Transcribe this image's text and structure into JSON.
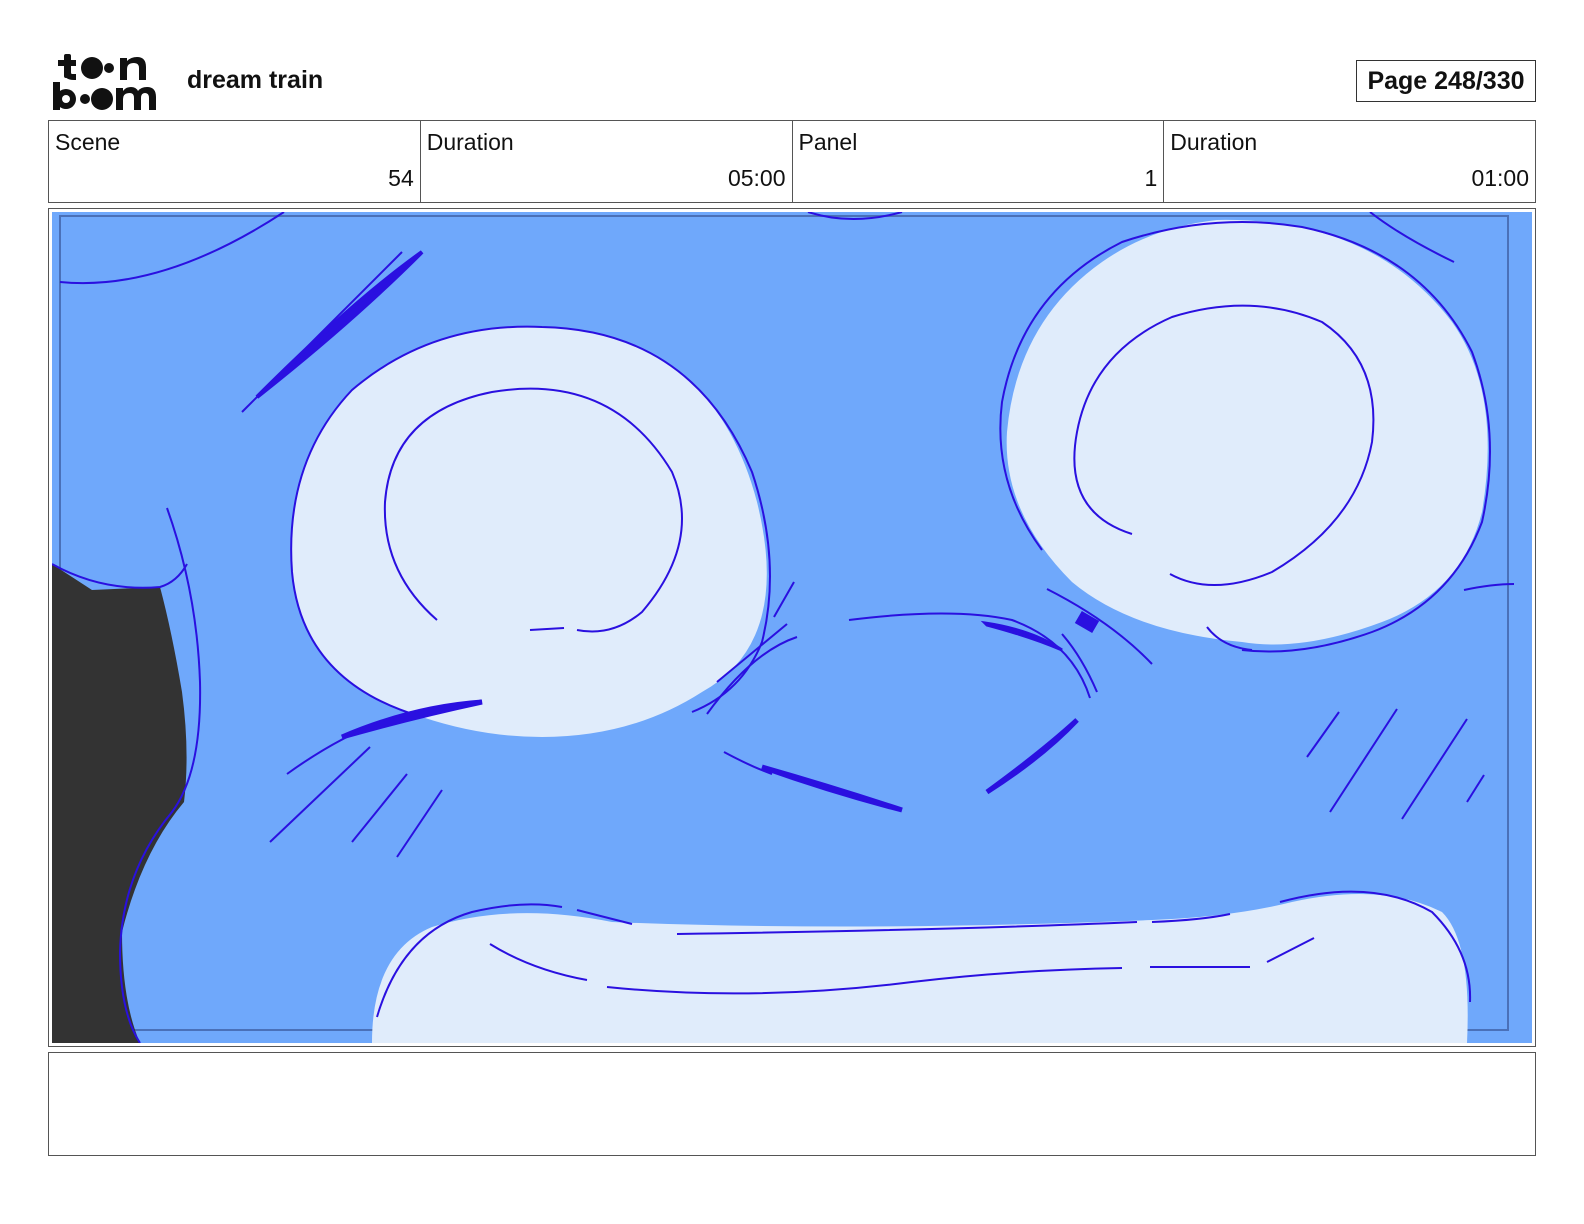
{
  "header": {
    "logo_text": "toon boom",
    "project_title": "dream train",
    "page_indicator": "Page 248/330"
  },
  "info": {
    "scene_label": "Scene",
    "scene_value": "54",
    "scene_duration_label": "Duration",
    "scene_duration_value": "05:00",
    "panel_label": "Panel",
    "panel_value": "1",
    "panel_duration_label": "Duration",
    "panel_duration_value": "01:00"
  },
  "colors": {
    "background_blue": "#6fa8fb",
    "highlight_blue": "#e0ecfb",
    "line_blue": "#2a10e0",
    "dark_shape": "#333333"
  },
  "notes": {
    "text": ""
  }
}
